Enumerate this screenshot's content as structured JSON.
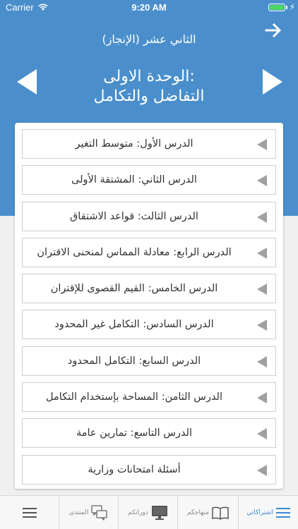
{
  "status_bar": {
    "carrier": "Carrier",
    "time": "9:20 AM"
  },
  "header": {
    "subject": "الثاني عشر (الإنجاز)",
    "unit_line1": "الوحدة الاولى:",
    "unit_line2": "التفاضل والتكامل"
  },
  "lessons": [
    {
      "label": "الدرس الأول: متوسط التغير"
    },
    {
      "label": "الدرس الثاني: المشتقة الأولى"
    },
    {
      "label": "الدرس الثالث: قواعد الاشتقاق"
    },
    {
      "label": "الدرس الرابع: معادلة المماس لمنحنى الاقتران"
    },
    {
      "label": "الدرس الخامس: القيم القصوى للإقتران"
    },
    {
      "label": "الدرس السادس: التكامل غير المحدود"
    },
    {
      "label": "الدرس السابع: التكامل المحدود"
    },
    {
      "label": "الدرس الثامن: المساحة بإستخدام التكامل"
    },
    {
      "label": "الدرس التاسع: تمارين عامة"
    },
    {
      "label": "أسئلة امتحانات وزارية"
    }
  ],
  "tabbar": {
    "subscriptions": "اشتراكاتي",
    "curricula": "منهاجكم",
    "courses": "دوراتكم",
    "forum": "المنتدى"
  },
  "colors": {
    "header_blue": "#4a8fcb",
    "active_tab": "#3a8ad6"
  },
  "icons": {
    "back": "arrow-right-icon",
    "prev": "triangle-left-icon",
    "next": "triangle-right-icon",
    "lesson": "triangle-left-icon",
    "menu": "menu-icon",
    "forum": "chat-bubbles-icon",
    "courses": "monitor-icon",
    "curricula": "open-book-icon",
    "subscriptions": "list-icon"
  }
}
